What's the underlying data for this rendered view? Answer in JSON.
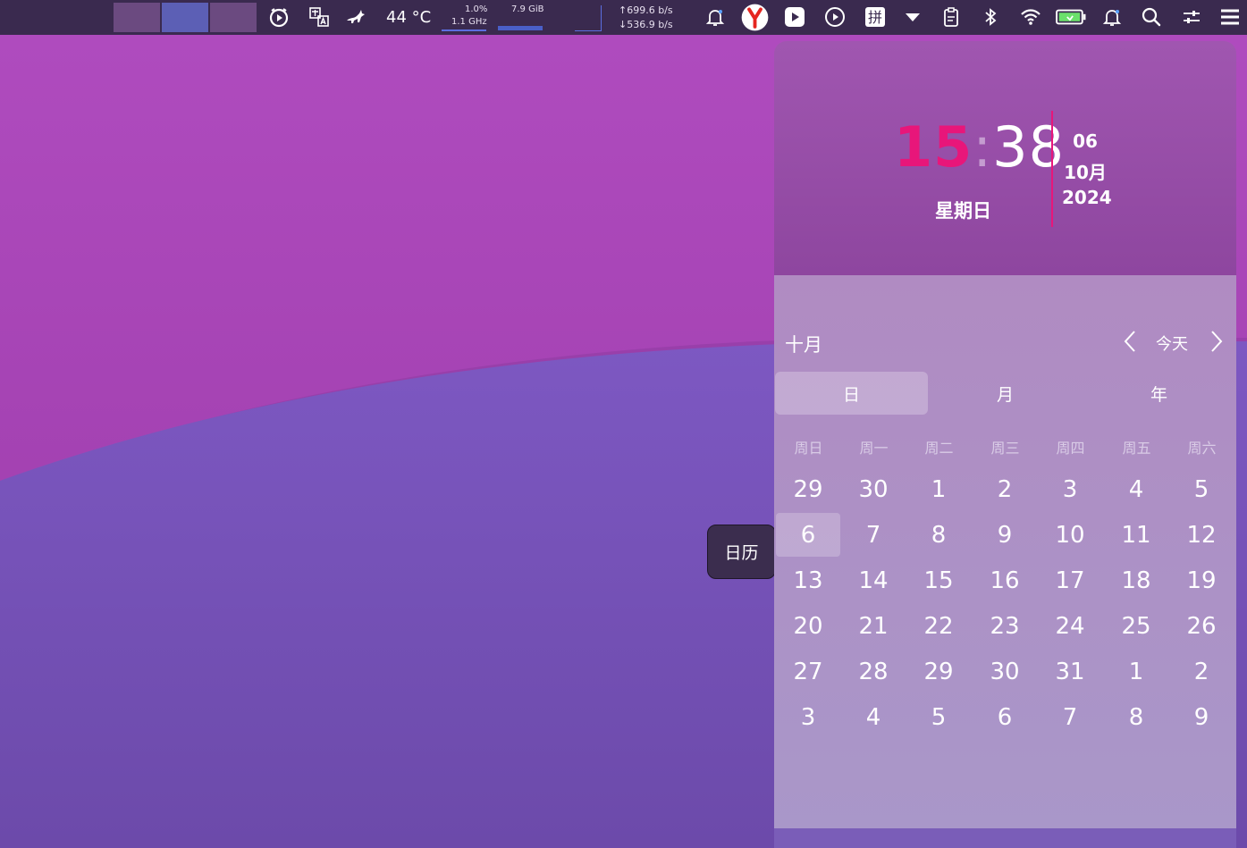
{
  "panel": {
    "temperature": "44 °C",
    "cpu_usage": "1.0%",
    "cpu_freq": "1.1 GHz",
    "memory": "7.9 GiB",
    "net_up": "↑699.6 b/s",
    "net_down": "↓536.9 b/s",
    "icons": [
      "alarm-icon",
      "translate-icon",
      "fox-icon",
      "notification-bell-icon",
      "yandex-browser-icon",
      "media-play-icon",
      "play-circle-icon",
      "pinyin-input-icon",
      "dropdown-arrow-icon",
      "clipboard-icon",
      "bluetooth-icon",
      "wifi-icon",
      "battery-icon",
      "notifications-icon",
      "search-icon",
      "settings-sliders-icon",
      "menu-icon"
    ],
    "pinyin_glyph": "拼"
  },
  "tooltip": {
    "label": "日历"
  },
  "clock": {
    "hours": "15",
    "colon": ":",
    "minutes": "38",
    "weekday": "星期日",
    "day": "06",
    "month": "10月",
    "year": "2024",
    "accent_color": "#e8167a"
  },
  "calendar": {
    "month_title": "十月",
    "today_button": "今天",
    "tabs": [
      {
        "label": "日",
        "active": true
      },
      {
        "label": "月",
        "active": false
      },
      {
        "label": "年",
        "active": false
      }
    ],
    "weekdays": [
      "周日",
      "周一",
      "周二",
      "周三",
      "周四",
      "周五",
      "周六"
    ],
    "weeks": [
      [
        "29",
        "30",
        "1",
        "2",
        "3",
        "4",
        "5"
      ],
      [
        "6",
        "7",
        "8",
        "9",
        "10",
        "11",
        "12"
      ],
      [
        "13",
        "14",
        "15",
        "16",
        "17",
        "18",
        "19"
      ],
      [
        "20",
        "21",
        "22",
        "23",
        "24",
        "25",
        "26"
      ],
      [
        "27",
        "28",
        "29",
        "30",
        "31",
        "1",
        "2"
      ],
      [
        "3",
        "4",
        "5",
        "6",
        "7",
        "8",
        "9"
      ]
    ],
    "today_cell": {
      "week": 1,
      "day": 0
    }
  }
}
